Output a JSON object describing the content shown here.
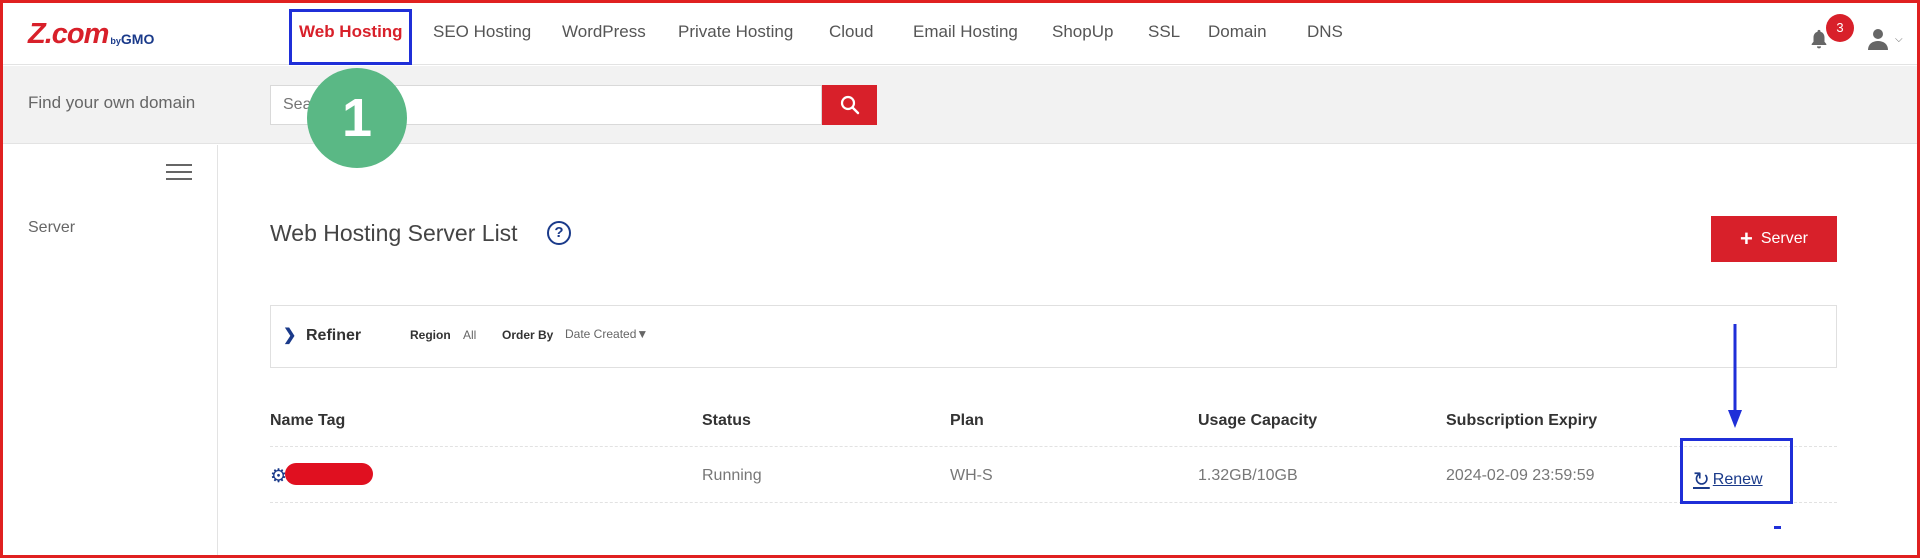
{
  "nav": {
    "logo_main": "Z.com",
    "logo_by": "by",
    "logo_gmo": "GMO",
    "items": [
      {
        "label": "Web Hosting",
        "active": true
      },
      {
        "label": "SEO Hosting"
      },
      {
        "label": "WordPress"
      },
      {
        "label": "Private Hosting"
      },
      {
        "label": "Cloud"
      },
      {
        "label": "Email Hosting"
      },
      {
        "label": "ShopUp"
      },
      {
        "label": "SSL"
      },
      {
        "label": "Domain"
      },
      {
        "label": "DNS"
      }
    ],
    "notification_count": "3",
    "icons": [
      "bell-icon",
      "user-icon",
      "chevron-down-icon"
    ]
  },
  "search": {
    "label": "Find your own domain",
    "placeholder": "Search"
  },
  "annotation": {
    "step_number": "1"
  },
  "sidebar": {
    "items": [
      {
        "label": "Server"
      }
    ]
  },
  "main": {
    "title": "Web Hosting Server List",
    "help_symbol": "?",
    "add_button_label": "Server",
    "refiner": {
      "label": "Refiner",
      "region_label": "Region",
      "region_value": "All",
      "order_label": "Order By",
      "order_value": "Date Created▼"
    },
    "table": {
      "headers": [
        "Name Tag",
        "Status",
        "Plan",
        "Usage Capacity",
        "Subscription Expiry"
      ],
      "rows": [
        {
          "name_tag": "",
          "status": "Running",
          "plan": "WH-S",
          "usage": "1.32GB/10GB",
          "expiry": "2024-02-09 23:59:59",
          "action": "Renew"
        }
      ]
    }
  },
  "colors": {
    "brand_red": "#d8202a",
    "brand_blue": "#1a3a8a",
    "annotation_blue": "#1f2fd8",
    "step_green": "#5ab885"
  }
}
